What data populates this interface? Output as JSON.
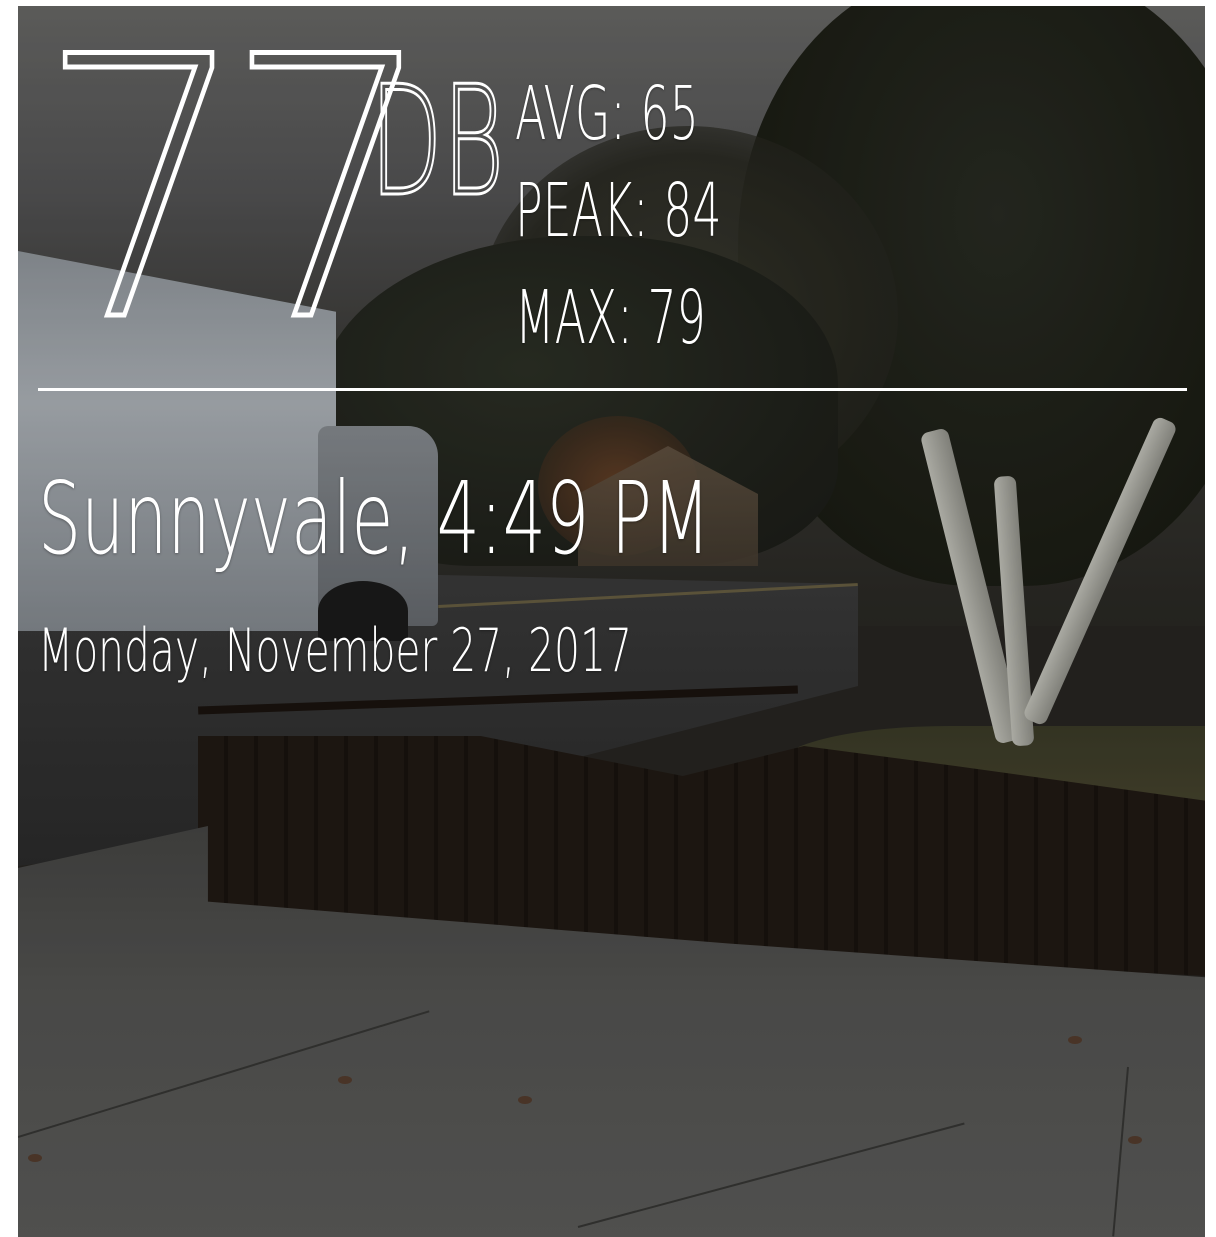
{
  "sound_meter": {
    "current_value": "77",
    "unit": "DB",
    "avg": "AVG: 65",
    "peak": "PEAK: 84",
    "max": "MAX: 79"
  },
  "location_time": "Sunnyvale, 4:49 PM",
  "date": "Monday, November 27, 2017",
  "colors": {
    "overlay_text": "#ffffff",
    "divider": "#ffffff"
  }
}
